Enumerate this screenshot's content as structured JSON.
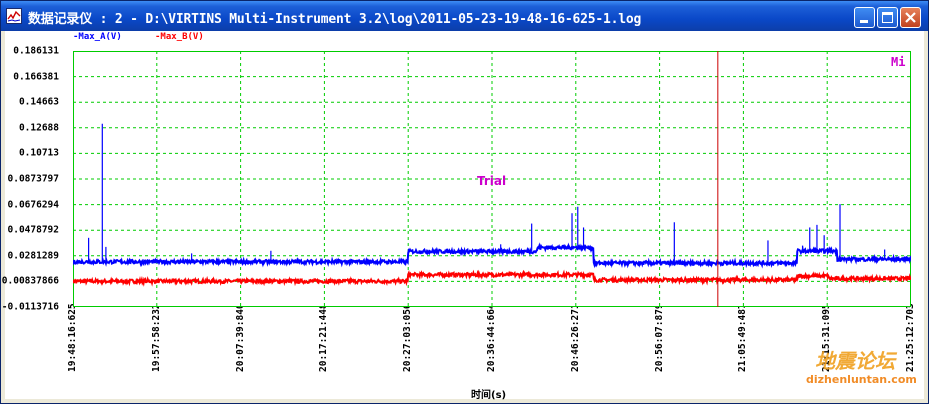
{
  "window": {
    "title": "数据记录仪 : 2 - D:\\VIRTINS Multi-Instrument 3.2\\log\\2011-05-23-19-48-16-625-1.log",
    "buttons": {
      "minimize": "minimize-icon",
      "maximize": "maximize-icon",
      "close": "close-icon"
    }
  },
  "overlay_text": {
    "trial": "Trial",
    "mi": "Mi"
  },
  "watermark": {
    "cn": "地震论坛",
    "url": "dizhenluntan.com"
  },
  "colors": {
    "series_a": "#0000ff",
    "series_b": "#ff0000",
    "grid": "#00cc00",
    "cursor": "#cc0000",
    "label_magenta": "#cc00cc"
  },
  "chart_data": {
    "type": "line",
    "xlabel": "时间(s)",
    "ylabel": "",
    "ylim": [
      -0.0113716,
      0.186131
    ],
    "y_ticks": [
      "0.186131",
      "0.166381",
      "0.14663",
      "0.12688",
      "0.10713",
      "0.0873797",
      "0.0676294",
      "0.0478792",
      "0.0281289",
      "0.00837866",
      "-0.0113716"
    ],
    "x_ticks": [
      "19:48:16:625",
      "19:57:58:232",
      "20:07:39:840",
      "20:17:21:448",
      "20:27:03:056",
      "20:36:44:664",
      "20:46:26:271",
      "20:56:07:879",
      "21:05:49:487",
      "21:15:31:095",
      "21:25:12:703"
    ],
    "cursor_x": "21:02:52",
    "series": [
      {
        "name": "-Max_A(V)",
        "color": "#0000ff",
        "baseline": [
          [
            "19:48:16",
            0.0235
          ],
          [
            "20:27:03",
            0.0235
          ],
          [
            "20:27:03",
            0.0315
          ],
          [
            "20:42:00",
            0.0315
          ],
          [
            "20:42:00",
            0.0345
          ],
          [
            "20:48:30",
            0.0345
          ],
          [
            "20:48:30",
            0.0225
          ],
          [
            "21:12:00",
            0.0225
          ],
          [
            "21:12:00",
            0.0318
          ],
          [
            "21:16:40",
            0.0318
          ],
          [
            "21:16:40",
            0.0255
          ],
          [
            "21:25:12",
            0.0255
          ]
        ],
        "spikes": [
          [
            "19:50:05",
            0.042
          ],
          [
            "19:51:40",
            0.13
          ],
          [
            "19:52:05",
            0.035
          ],
          [
            "20:02:00",
            0.03
          ],
          [
            "20:11:10",
            0.032
          ],
          [
            "20:37:45",
            0.037
          ],
          [
            "20:41:20",
            0.053
          ],
          [
            "20:46:00",
            0.061
          ],
          [
            "20:46:40",
            0.066
          ],
          [
            "20:47:20",
            0.05
          ],
          [
            "20:57:50",
            0.054
          ],
          [
            "21:08:40",
            0.04
          ],
          [
            "21:12:40",
            0.036
          ],
          [
            "21:13:30",
            0.05
          ],
          [
            "21:14:20",
            0.052
          ],
          [
            "21:15:10",
            0.044
          ],
          [
            "21:17:00",
            0.068
          ],
          [
            "21:22:10",
            0.033
          ]
        ]
      },
      {
        "name": "-Max_B(V)",
        "color": "#ff0000",
        "baseline": [
          [
            "19:48:16",
            0.0085
          ],
          [
            "20:27:03",
            0.0085
          ],
          [
            "20:27:03",
            0.0135
          ],
          [
            "20:48:30",
            0.0135
          ],
          [
            "20:48:30",
            0.0095
          ],
          [
            "21:12:00",
            0.0095
          ],
          [
            "21:12:00",
            0.0125
          ],
          [
            "21:15:40",
            0.0125
          ],
          [
            "21:15:40",
            0.0105
          ],
          [
            "21:25:12",
            0.0105
          ]
        ],
        "spikes": []
      }
    ]
  }
}
